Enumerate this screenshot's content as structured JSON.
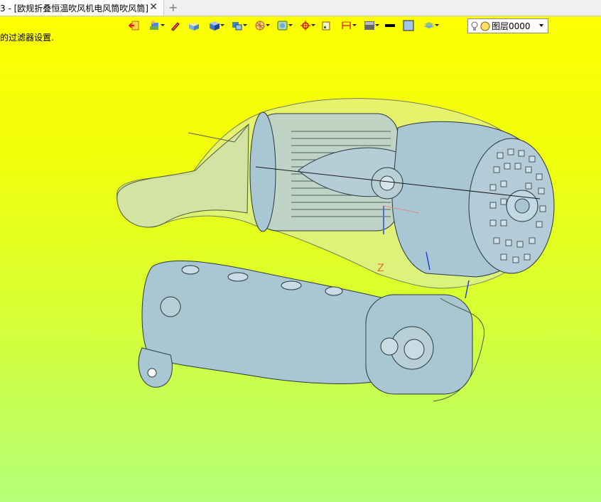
{
  "tab": {
    "title": "3 - [欧规折叠恒温吹风机电风筒吹风筒]",
    "close_glyph": "✕",
    "new_tab_glyph": "+"
  },
  "toolbar": {
    "buttons": [
      {
        "name": "exit-icon",
        "dropdown": false
      },
      {
        "name": "layers-view-icon",
        "dropdown": true
      },
      {
        "name": "pen-icon",
        "dropdown": false
      },
      {
        "name": "shaded-solid-icon",
        "dropdown": false
      },
      {
        "name": "cube-view-icon",
        "dropdown": true
      },
      {
        "name": "display-mode-icon",
        "dropdown": true
      },
      {
        "name": "section-view-icon",
        "dropdown": true
      },
      {
        "name": "render-style-icon",
        "dropdown": true
      },
      {
        "name": "orient-icon",
        "dropdown": true
      },
      {
        "name": "work-plane-icon",
        "dropdown": false
      },
      {
        "name": "dimension-icon",
        "dropdown": true
      },
      {
        "name": "background-icon",
        "dropdown": true
      },
      {
        "name": "line-color-icon",
        "dropdown": false
      },
      {
        "name": "face-color-icon",
        "dropdown": false
      },
      {
        "name": "layer-stack-icon",
        "dropdown": true
      }
    ],
    "layer": {
      "label": "图层0000"
    }
  },
  "status": {
    "message": "的过滤器设置."
  },
  "colors": {
    "model": "#a9c6d3",
    "shell": "#cfe0c0",
    "edges": "#2a3a40"
  }
}
